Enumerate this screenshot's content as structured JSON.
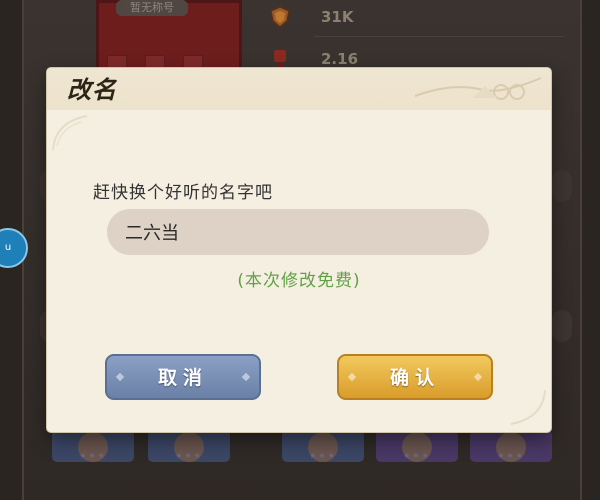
{
  "background": {
    "title_tag": "暂无称号",
    "stat_1_value": "31K",
    "stat_2_value": "2.16",
    "bubble_label": "u"
  },
  "dialog": {
    "title": "改名",
    "prompt": "赶快换个好听的名字吧",
    "name_input": {
      "value": "二六当",
      "placeholder": ""
    },
    "free_note": "(本次修改免费)",
    "cancel_label": "取消",
    "confirm_label": "确认"
  },
  "colors": {
    "dialog_bg": "#f5efe2",
    "cancel_button": "#7b90b5",
    "confirm_button": "#e6b243",
    "free_note": "#62a046"
  },
  "icons": [
    "shield-icon",
    "trophy-icon",
    "ornament-icon"
  ]
}
